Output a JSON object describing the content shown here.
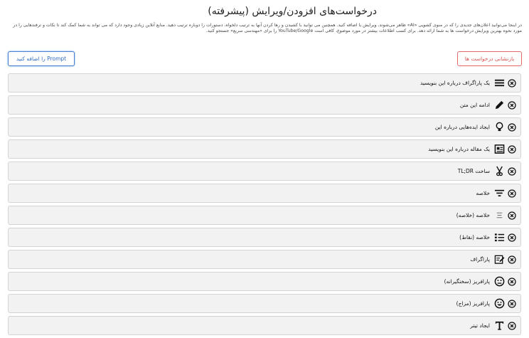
{
  "header": {
    "title": "درخواست‌های افزودن/ویرایش (پیشرفته)",
    "description": "در اینجا می‌توانید اعلان‌های جدیدی را که در منوی کشویی «AI» ظاهر می‌شوند، ویرایش یا اضافه کنید. همچنین می توانید با کشیدن و رها کردن آنها به ترتیب دلخواه، دستورات را دوباره ترتیب دهید. منابع آنلاین زیادی وجود دارد که می تواند به شما کمک کند تا نکات و ترفندهایی را در مورد نحوه بهترین ویرایش درخواست ها به شما ارائه دهد. برای کسب اطلاعات بیشتر در مورد موضوع، کافی است YouTube/Google را برای «مهندسی سریع» جستجو کنید."
  },
  "toolbar": {
    "reset_label": "بازنشانی درخواست ها",
    "add_label": "Prompt را اضافه کنید"
  },
  "prompts": [
    {
      "label": "یک پاراگراف درباره این بنویسید",
      "icon": "paragraph-lines-icon"
    },
    {
      "label": "ادامه این متن",
      "icon": "pencil-icon"
    },
    {
      "label": "ایجاد ایده‌هایی درباره این",
      "icon": "lightbulb-icon"
    },
    {
      "label": "یک مقاله درباره این بنویسید",
      "icon": "newspaper-icon"
    },
    {
      "label": "ساخت TL;DR",
      "icon": "scissors-icon"
    },
    {
      "label": "خلاصه",
      "icon": "filter-lines-icon"
    },
    {
      "label": "خلاصه (خلاصه)",
      "icon": "short-lines-icon"
    },
    {
      "label": "خلاصه (نقاط)",
      "icon": "bullet-list-icon"
    },
    {
      "label": "پاراگراف",
      "icon": "edit-note-icon"
    },
    {
      "label": "پارافریز (سختگیرانه)",
      "icon": "strict-face-icon"
    },
    {
      "label": "پارافریز (مزاج)",
      "icon": "smile-face-icon"
    },
    {
      "label": "ایجاد تیتر",
      "icon": "text-t-icon"
    }
  ]
}
